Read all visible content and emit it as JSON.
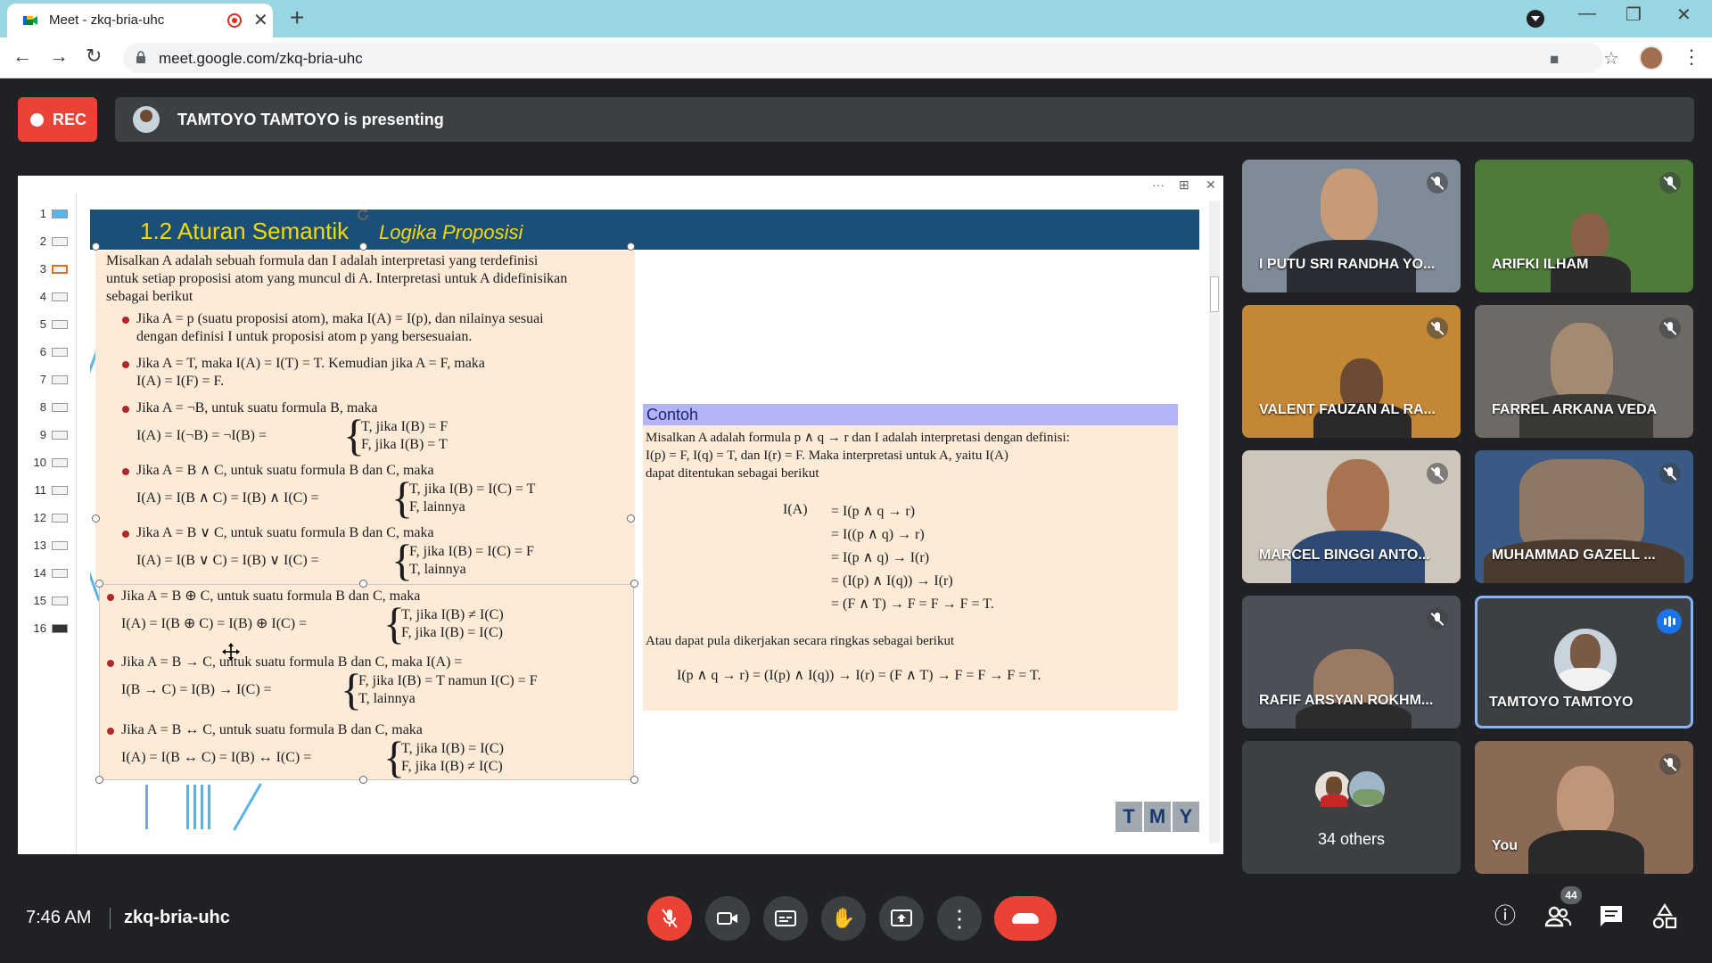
{
  "browser": {
    "tab_title": "Meet - zkq-bria-uhc",
    "tab_close": "✕",
    "new_tab": "+",
    "url": "meet.google.com/zkq-bria-uhc",
    "back": "←",
    "forward": "→",
    "reload": "↻",
    "minimize": "—",
    "restore": "❐",
    "close": "✕",
    "camera_icon": "■",
    "star_icon": "☆",
    "menu_icon": "⋮"
  },
  "meet": {
    "rec_label": "REC",
    "presenting_text": "TAMTOYO TAMTOYO is presenting",
    "time": "7:46 AM",
    "meeting_code": "zkq-bria-uhc",
    "participant_count": "44"
  },
  "present_toolbar": {
    "more": "···",
    "expand": "⊞",
    "close": "✕"
  },
  "slide_thumbs": [
    "1",
    "2",
    "3",
    "4",
    "5",
    "6",
    "7",
    "8",
    "9",
    "10",
    "11",
    "12",
    "13",
    "14",
    "15",
    "16"
  ],
  "slide": {
    "title_main": "1.2  Aturan Semantik",
    "title_sub": "Logika Proposisi",
    "intro": [
      "Misalkan A adalah sebuah formula dan I adalah interpretasi yang terdefinisi",
      "untuk setiap proposisi atom yang muncul di A.  Interpretasi untuk A didefinisikan",
      "sebagai berikut"
    ],
    "rules": [
      {
        "lines": [
          "Jika A = p (suatu proposisi atom), maka I(A) = I(p), dan nilainya sesuai",
          "dengan definisi I untuk proposisi atom p yang bersesuaian."
        ]
      },
      {
        "lines": [
          "Jika A = T, maka I(A) = I(T) = T.  Kemudian jika A = F, maka",
          "I(A) = I(F) = F."
        ]
      },
      {
        "lines": [
          "Jika A = ¬B, untuk suatu formula B, maka"
        ],
        "lhs": "I(A) = I(¬B) = ¬I(B) =",
        "cases": [
          "T,   jika I(B) = F",
          "F,   jika I(B) = T"
        ]
      },
      {
        "lines": [
          "Jika A = B ∧ C, untuk suatu formula B dan C, maka"
        ],
        "lhs": "I(A) = I(B ∧ C) = I(B) ∧ I(C) =",
        "cases": [
          "T,   jika I(B) = I(C) = T",
          "F,   lainnya"
        ]
      },
      {
        "lines": [
          "Jika A = B ∨ C, untuk suatu formula B dan C, maka"
        ],
        "lhs": "I(A) = I(B ∨ C) = I(B) ∨ I(C) =",
        "cases": [
          "F,   jika I(B) = I(C) = F",
          "T,   lainnya"
        ]
      },
      {
        "lines": [
          "Jika A = B ⊕ C, untuk suatu formula B dan C, maka"
        ],
        "lhs": "I(A) = I(B ⊕ C) = I(B) ⊕ I(C) =",
        "cases": [
          "T,   jika I(B) ≠ I(C)",
          "F,   jika I(B) = I(C)"
        ]
      },
      {
        "lines": [
          "Jika A = B → C, untuk suatu formula B dan C, maka I(A) ="
        ],
        "lhs": "I(B → C) = I(B) → I(C) =",
        "cases": [
          "F,   jika I(B) = T namun I(C) = F",
          "T,   lainnya"
        ]
      },
      {
        "lines": [
          "Jika A = B ↔ C, untuk suatu formula B dan C, maka"
        ],
        "lhs": "I(A) = I(B ↔ C) = I(B) ↔ I(C) =",
        "cases": [
          "T,   jika I(B) = I(C)",
          "F,   jika I(B) ≠ I(C)"
        ]
      }
    ],
    "contoh_title": "Contoh",
    "contoh_text": [
      "Misalkan A adalah formula p ∧ q → r dan I adalah interpretasi dengan definisi:",
      "I(p) = F, I(q) = T, dan I(r) = F.  Maka interpretasi untuk A, yaitu I(A)",
      "dapat ditentukan sebagai berikut"
    ],
    "contoh_lhs": "I(A)",
    "contoh_eqs": [
      "=   I(p ∧ q → r)",
      "=   I((p ∧ q) → r)",
      "=   I(p ∧ q) → I(r)",
      "=   (I(p) ∧ I(q)) → I(r)",
      "=   (F ∧ T) → F = F → F = T."
    ],
    "contoh_alt": "Atau dapat pula dikerjakan secara ringkas sebagai berikut",
    "contoh_short": "I(p ∧ q → r) = (I(p) ∧ I(q)) → I(r) = (F ∧ T) → F = F → F = T.",
    "tmy": [
      "T",
      "M",
      "Y"
    ]
  },
  "participants": [
    {
      "name": "I PUTU SRI RANDHA YO...",
      "bg": "#7f8b96",
      "skin": "#c99a76",
      "shirt": "#2a2e34"
    },
    {
      "name": "ARIFKI ILHAM",
      "bg": "#4f7a3a",
      "skin": "#8a6048",
      "shirt": "#2b2b2b"
    },
    {
      "name": "VALENT FAUZAN AL RA...",
      "bg": "#c48736",
      "skin": "#6d4a33",
      "shirt": "#2c2a28"
    },
    {
      "name": "FARREL ARKANA VEDA",
      "bg": "#6d6a66",
      "skin": "#a58a72",
      "shirt": "#3b3936"
    },
    {
      "name": "MARCEL BINGGI ANTO...",
      "bg": "#cfc6bb",
      "skin": "#a87452",
      "shirt": "#2f4a72"
    },
    {
      "name": "MUHAMMAD GAZELL ...",
      "bg": "#3a5a86",
      "skin": "#8f7766",
      "shirt": "#4b3a2e"
    },
    {
      "name": "RAFIF ARSYAN ROKHM...",
      "bg": "#4b5058",
      "skin": "#9a7a62",
      "shirt": "#2c2c2c"
    },
    {
      "name": "TAMTOYO TAMTOYO",
      "bg": "#3c4043",
      "skin": "#7a5a44",
      "shirt": "#f2f2f2"
    },
    {
      "name": "34 others",
      "bg": "#3c4043"
    },
    {
      "name": "You",
      "bg": "#8b6a55",
      "skin": "#c19577",
      "shirt": "#2a2a2a"
    }
  ],
  "controls": {
    "mic": "🎤",
    "camera": "📷",
    "captions": "CC",
    "raise_hand": "✋",
    "present": "⬆",
    "more": "⋮",
    "info": "ⓘ",
    "people": "👥",
    "chat": "💬",
    "activities": "⚙"
  }
}
